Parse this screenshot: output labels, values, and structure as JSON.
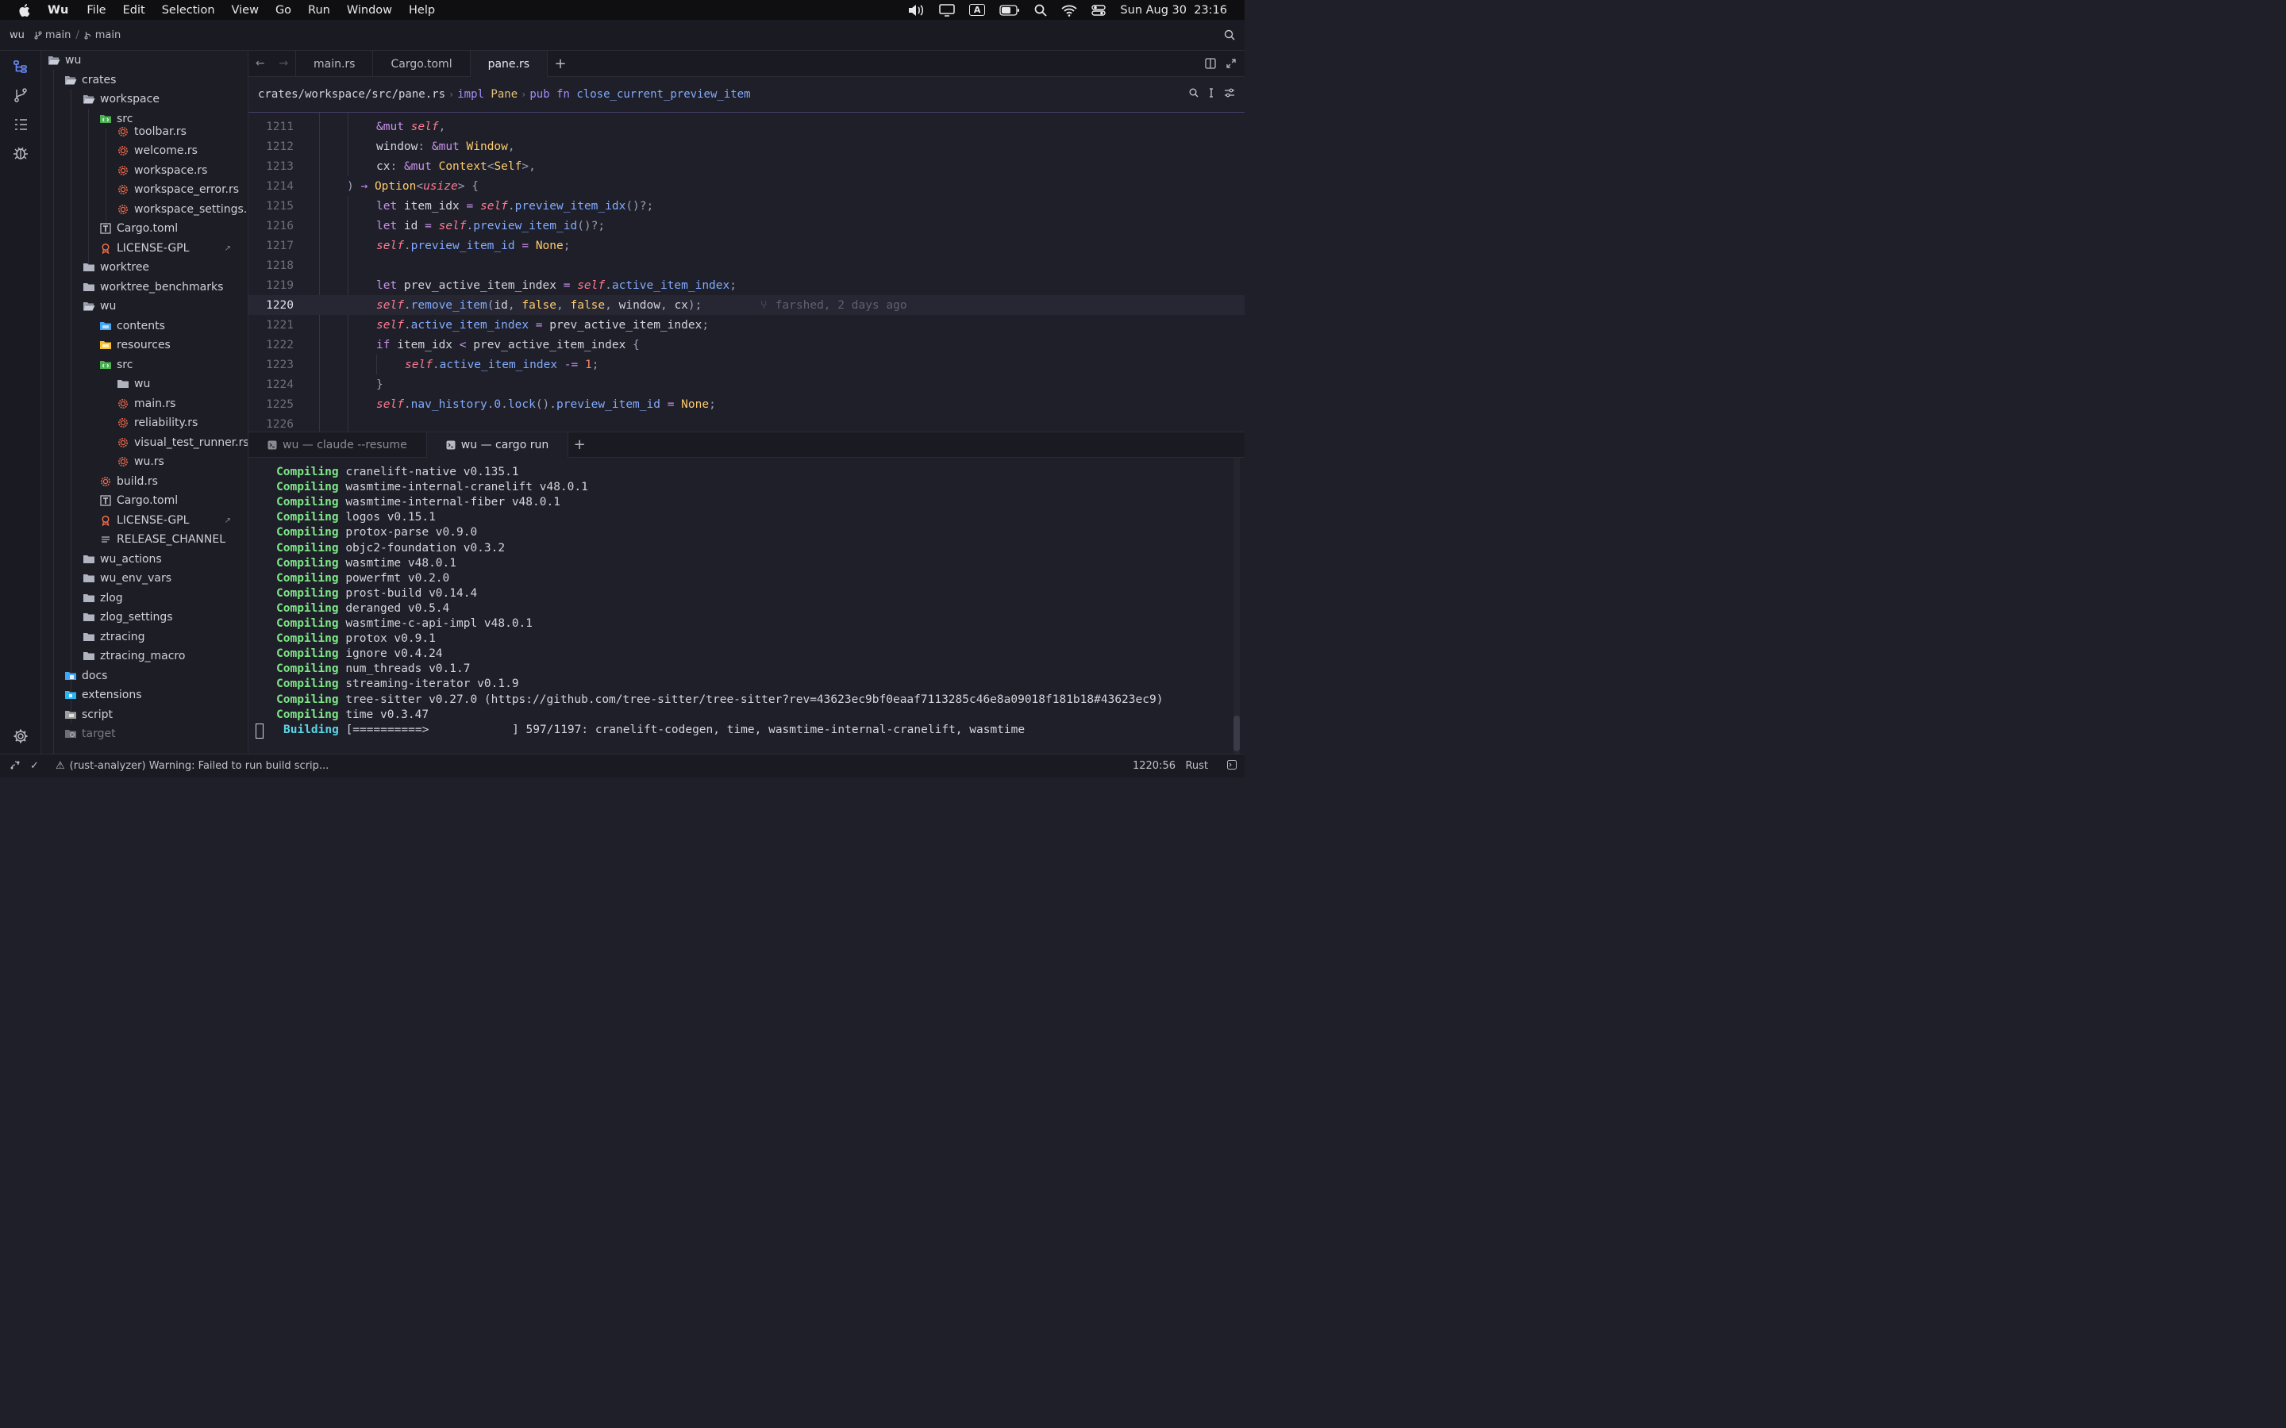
{
  "menubar": {
    "app_name": "Wu",
    "items": [
      "File",
      "Edit",
      "Selection",
      "View",
      "Go",
      "Run",
      "Window",
      "Help"
    ],
    "clock": "Sun Aug 30  23:16",
    "input_source": "A"
  },
  "titlebar": {
    "project": "wu",
    "branch1": "main",
    "branch2": "main"
  },
  "tree": [
    {
      "label": "wu",
      "depth": 0,
      "icon": "folder-open"
    },
    {
      "label": "crates",
      "depth": 1,
      "icon": "folder-open"
    },
    {
      "label": "workspace",
      "depth": 2,
      "icon": "folder-open"
    },
    {
      "label": "src",
      "depth": 3,
      "icon": "folder-src"
    },
    {
      "label": "toolbar.rs",
      "depth": 4,
      "icon": "rust"
    },
    {
      "label": "welcome.rs",
      "depth": 4,
      "icon": "rust"
    },
    {
      "label": "workspace.rs",
      "depth": 4,
      "icon": "rust"
    },
    {
      "label": "workspace_error.rs",
      "depth": 4,
      "icon": "rust"
    },
    {
      "label": "workspace_settings.rs",
      "depth": 4,
      "icon": "rust"
    },
    {
      "label": "Cargo.toml",
      "depth": 3,
      "icon": "toml"
    },
    {
      "label": "LICENSE-GPL",
      "depth": 3,
      "icon": "license",
      "ext": "↗"
    },
    {
      "label": "worktree",
      "depth": 2,
      "icon": "folder"
    },
    {
      "label": "worktree_benchmarks",
      "depth": 2,
      "icon": "folder"
    },
    {
      "label": "wu",
      "depth": 2,
      "icon": "folder-open"
    },
    {
      "label": "contents",
      "depth": 3,
      "icon": "folder-blue"
    },
    {
      "label": "resources",
      "depth": 3,
      "icon": "folder-yellow"
    },
    {
      "label": "src",
      "depth": 3,
      "icon": "folder-src"
    },
    {
      "label": "wu",
      "depth": 4,
      "icon": "folder"
    },
    {
      "label": "main.rs",
      "depth": 4,
      "icon": "rust"
    },
    {
      "label": "reliability.rs",
      "depth": 4,
      "icon": "rust"
    },
    {
      "label": "visual_test_runner.rs",
      "depth": 4,
      "icon": "rust"
    },
    {
      "label": "wu.rs",
      "depth": 4,
      "icon": "rust"
    },
    {
      "label": "build.rs",
      "depth": 3,
      "icon": "rust"
    },
    {
      "label": "Cargo.toml",
      "depth": 3,
      "icon": "toml"
    },
    {
      "label": "LICENSE-GPL",
      "depth": 3,
      "icon": "license",
      "ext": "↗"
    },
    {
      "label": "RELEASE_CHANNEL",
      "depth": 3,
      "icon": "text"
    },
    {
      "label": "wu_actions",
      "depth": 2,
      "icon": "folder"
    },
    {
      "label": "wu_env_vars",
      "depth": 2,
      "icon": "folder"
    },
    {
      "label": "zlog",
      "depth": 2,
      "icon": "folder"
    },
    {
      "label": "zlog_settings",
      "depth": 2,
      "icon": "folder"
    },
    {
      "label": "ztracing",
      "depth": 2,
      "icon": "folder"
    },
    {
      "label": "ztracing_macro",
      "depth": 2,
      "icon": "folder"
    },
    {
      "label": "docs",
      "depth": 1,
      "icon": "folder-docs"
    },
    {
      "label": "extensions",
      "depth": 1,
      "icon": "folder-ext"
    },
    {
      "label": "script",
      "depth": 1,
      "icon": "folder-script"
    },
    {
      "label": "target",
      "depth": 1,
      "icon": "folder-target",
      "dim": true
    }
  ],
  "tabs": [
    {
      "label": "main.rs",
      "active": false
    },
    {
      "label": "Cargo.toml",
      "active": false
    },
    {
      "label": "pane.rs",
      "active": true
    }
  ],
  "breadcrumb": {
    "path": "crates/workspace/src/pane.rs",
    "impl_kw": "impl",
    "impl_type": "Pane",
    "fn_kw": "pub fn",
    "fn_name": "close_current_preview_item"
  },
  "code": [
    {
      "ln": "1211",
      "html": "<span class=\"k\">&amp;mut</span> <span class=\"s\">self</span><span class=\"p\">,</span>",
      "indent": 2
    },
    {
      "ln": "1212",
      "html": "window<span class=\"p\">:</span> <span class=\"k\">&amp;mut</span> <span class=\"t\">Window</span><span class=\"p\">,</span>",
      "indent": 2
    },
    {
      "ln": "1213",
      "html": "cx<span class=\"p\">:</span> <span class=\"k\">&amp;mut</span> <span class=\"t\">Context</span><span class=\"p\">&lt;</span><span class=\"t\">Self</span><span class=\"p\">&gt;,</span>",
      "indent": 2
    },
    {
      "ln": "1214",
      "html": "<span class=\"p\">)</span> <span class=\"k\">→</span> <span class=\"t\">Option</span><span class=\"p\">&lt;</span><span class=\"s\">usize</span><span class=\"p\">&gt;</span> <span class=\"p\">{</span>",
      "indent": 1
    },
    {
      "ln": "1215",
      "html": "<span class=\"k\">let</span> item_idx <span class=\"k\">=</span> <span class=\"s\">self</span><span class=\"p\">.</span><span class=\"f\">preview_item_idx</span><span class=\"p\">()?;</span>",
      "indent": 2
    },
    {
      "ln": "1216",
      "html": "<span class=\"k\">let</span> id <span class=\"k\">=</span> <span class=\"s\">self</span><span class=\"p\">.</span><span class=\"f\">preview_item_id</span><span class=\"p\">()?;</span>",
      "indent": 2
    },
    {
      "ln": "1217",
      "html": "<span class=\"s\">self</span><span class=\"p\">.</span><span class=\"f\">preview_item_id</span> <span class=\"k\">=</span> <span class=\"t\">None</span><span class=\"p\">;</span>",
      "indent": 2
    },
    {
      "ln": "1218",
      "html": "",
      "indent": 2
    },
    {
      "ln": "1219",
      "html": "<span class=\"k\">let</span> prev_active_item_index <span class=\"k\">=</span> <span class=\"s\">self</span><span class=\"p\">.</span><span class=\"f\">active_item_index</span><span class=\"p\">;</span>",
      "indent": 2
    },
    {
      "ln": "1220",
      "html": "<span class=\"s\">self</span><span class=\"p\">.</span><span class=\"f\">remove_item</span><span class=\"p\">(</span>id<span class=\"p\">,</span> <span class=\"t\">false</span><span class=\"p\">,</span> <span class=\"t\">false</span><span class=\"p\">,</span> window<span class=\"p\">,</span> cx<span class=\"p\">);</span>",
      "indent": 2,
      "current": true,
      "blame": "farshed, 2 days ago"
    },
    {
      "ln": "1221",
      "html": "<span class=\"s\">self</span><span class=\"p\">.</span><span class=\"f\">active_item_index</span> <span class=\"k\">=</span> prev_active_item_index<span class=\"p\">;</span>",
      "indent": 2
    },
    {
      "ln": "1222",
      "html": "<span class=\"k\">if</span> item_idx <span class=\"k\">&lt;</span> prev_active_item_index <span class=\"p\">{</span>",
      "indent": 2
    },
    {
      "ln": "1223",
      "html": "<span class=\"s\">self</span><span class=\"p\">.</span><span class=\"f\">active_item_index</span> <span class=\"k\">-=</span> <span class=\"n\">1</span><span class=\"p\">;</span>",
      "indent": 3
    },
    {
      "ln": "1224",
      "html": "<span class=\"p\">}</span>",
      "indent": 2
    },
    {
      "ln": "1225",
      "html": "<span class=\"s\">self</span><span class=\"p\">.</span><span class=\"f\">nav_history</span><span class=\"p\">.</span><span class=\"f\">0</span><span class=\"p\">.</span><span class=\"f\">lock</span><span class=\"p\">().</span><span class=\"f\">preview_item_id</span> <span class=\"k\">=</span> <span class=\"t\">None</span><span class=\"p\">;</span>",
      "indent": 2
    },
    {
      "ln": "1226",
      "html": "",
      "indent": 2
    }
  ],
  "terminal_tabs": [
    {
      "label": "wu — claude --resume",
      "active": false
    },
    {
      "label": "wu — cargo run",
      "active": true
    }
  ],
  "terminal": {
    "compile_word": "Compiling",
    "lines": [
      "cranelift-native v0.135.1",
      "wasmtime-internal-cranelift v48.0.1",
      "wasmtime-internal-fiber v48.0.1",
      "logos v0.15.1",
      "protox-parse v0.9.0",
      "objc2-foundation v0.3.2",
      "wasmtime v48.0.1",
      "powerfmt v0.2.0",
      "prost-build v0.14.4",
      "deranged v0.5.4",
      "wasmtime-c-api-impl v48.0.1",
      "protox v0.9.1",
      "ignore v0.4.24",
      "num_threads v0.1.7",
      "streaming-iterator v0.1.9",
      "tree-sitter v0.27.0 (https://github.com/tree-sitter/tree-sitter?rev=43623ec9bf0eaaf7113285c46e8a09018f181b18#43623ec9)",
      "time v0.3.47"
    ],
    "building_word": "Building",
    "building_rest": "[==========>            ] 597/1197: cranelift-codegen, time, wasmtime-internal-cranelift, wasmtime"
  },
  "status": {
    "warning": "(rust-analyzer) Warning: Failed to run build scrip...",
    "position": "1220:56",
    "language": "Rust"
  }
}
